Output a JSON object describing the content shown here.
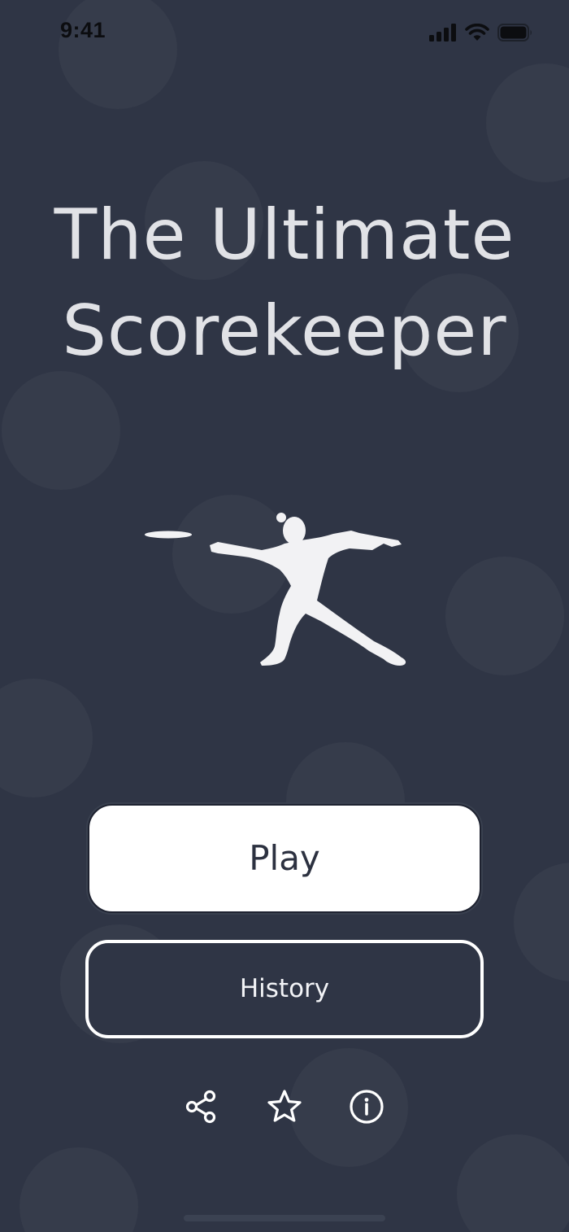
{
  "status_bar": {
    "time": "9:41",
    "icons": [
      "cellular-signal-icon",
      "wifi-icon",
      "battery-icon"
    ]
  },
  "title": {
    "line1": "The Ultimate",
    "line2": "Scorekeeper"
  },
  "illustration": {
    "name": "frisbee-thrower-silhouette"
  },
  "buttons": {
    "play_label": "Play",
    "history_label": "History"
  },
  "bottom_icons": [
    "share-icon",
    "star-icon",
    "info-icon"
  ],
  "colors": {
    "background": "#2f3545",
    "title_text": "#e1e2e6",
    "play_button_bg": "#ffffff",
    "play_button_text": "#2c3140",
    "history_border": "#ffffff",
    "icon": "#ffffff"
  }
}
